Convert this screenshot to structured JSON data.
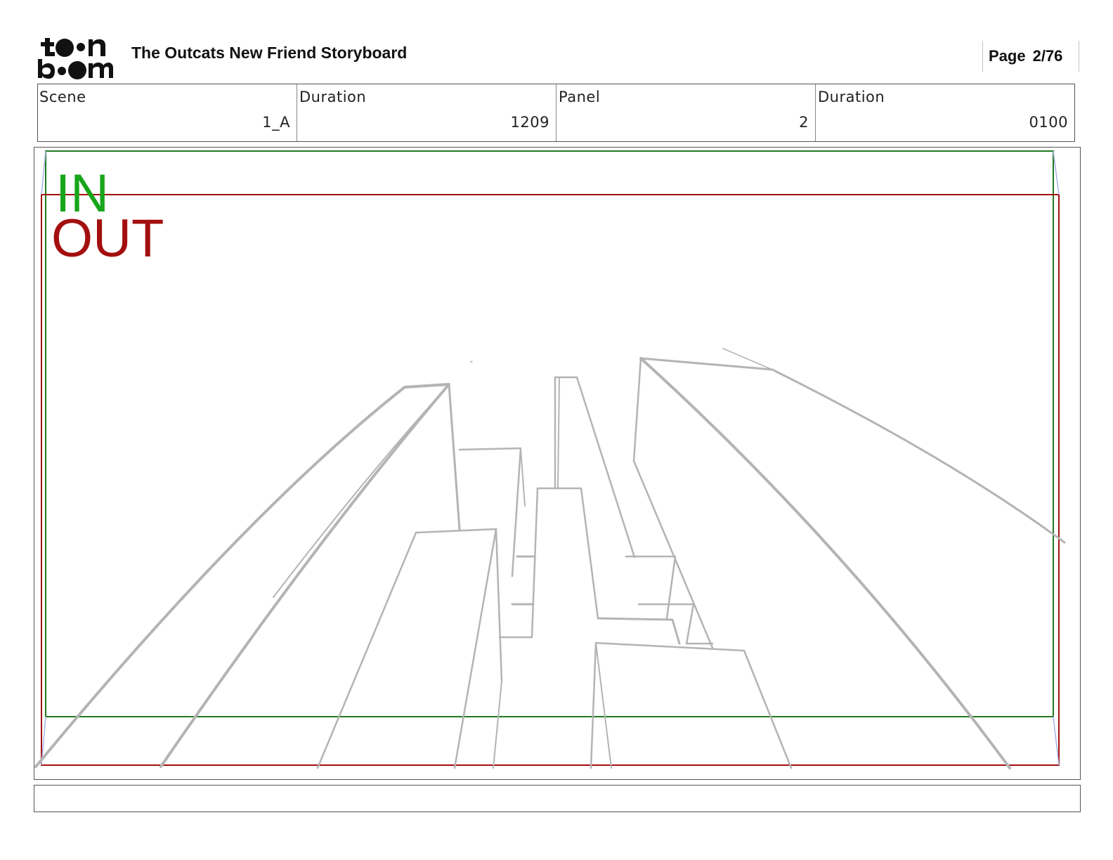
{
  "header": {
    "logo_text": "toon boom",
    "title": "The Outcats New Friend Storyboard",
    "page_label": "Page",
    "page_number": "2/76"
  },
  "info": {
    "scene_label": "Scene",
    "scene_value": "1_A",
    "scene_duration_label": "Duration",
    "scene_duration_value": "1209",
    "panel_label": "Panel",
    "panel_value": "2",
    "panel_duration_label": "Duration",
    "panel_duration_value": "0100"
  },
  "panel": {
    "in_label": "IN",
    "out_label": "OUT",
    "in_color": "#17a51a",
    "out_color": "#a30f0f",
    "sketch_color": "#b4b4b4"
  },
  "caption": {
    "text": ""
  }
}
